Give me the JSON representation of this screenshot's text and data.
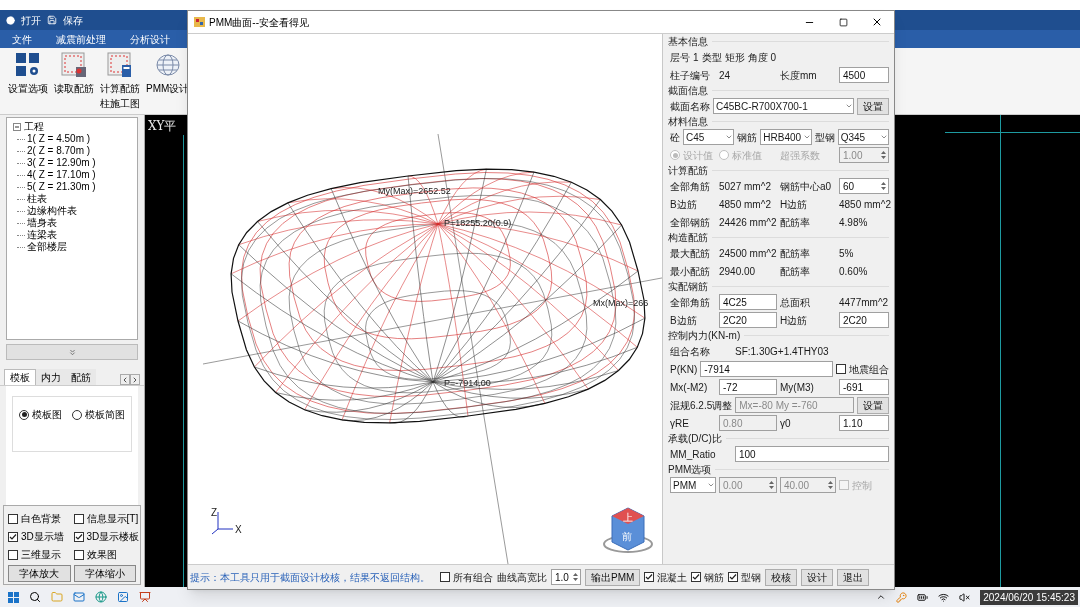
{
  "app": {
    "quick_access": [
      "打开",
      "保存"
    ],
    "menu": [
      "文件",
      "减震前处理",
      "分析设计"
    ],
    "toolbar": [
      {
        "label": "设置选项",
        "kind": "settings"
      },
      {
        "label": "读取配筋",
        "kind": "read"
      },
      {
        "label": "计算配筋",
        "sublabel": "柱施工图",
        "kind": "calc"
      },
      {
        "label": "PMM设计",
        "kind": "sphere"
      }
    ],
    "canvas_title": "XY平"
  },
  "left_panel": {
    "tree": {
      "label": "工程",
      "expanded": true,
      "children": [
        "1( Z = 4.50m )",
        "2( Z = 8.70m )",
        "3( Z = 12.90m )",
        "4( Z = 17.10m )",
        "5( Z = 21.30m )",
        "柱表",
        "边缘构件表",
        "墙身表",
        "连梁表",
        "全部楼层"
      ]
    },
    "tabs": [
      {
        "label": "模板",
        "selected": true
      },
      {
        "label": "内力",
        "selected": false
      },
      {
        "label": "配筋",
        "selected": false
      }
    ],
    "radios": [
      {
        "label": "模板图",
        "selected": true
      },
      {
        "label": "模板简图",
        "selected": false
      }
    ],
    "checkboxes": [
      {
        "label": "白色背景",
        "checked": false
      },
      {
        "label": "信息显示[T]",
        "checked": false
      },
      {
        "label": "3D显示墙",
        "checked": true
      },
      {
        "label": "3D显示楼板",
        "checked": true
      },
      {
        "label": "三维显示",
        "checked": false
      },
      {
        "label": "效果图",
        "checked": false
      }
    ],
    "buttons": [
      "字体放大",
      "字体缩小"
    ]
  },
  "dialog": {
    "title": "PMM曲面--安全看得见",
    "view": {
      "labels": [
        "My(Max)=2652.52",
        "P=18255.20(0.9)",
        "Mx(Max)=266",
        "P=-7914.00"
      ],
      "axes": [
        "Z",
        "X"
      ],
      "cube": [
        "上",
        "前"
      ]
    },
    "right_panel": {
      "sections": [
        {
          "title": "基本信息",
          "groups": [
            {
              "rows": [
                {
                  "cells": [
                    {
                      "kind": "label",
                      "text": "层号"
                    },
                    {
                      "kind": "text",
                      "text": "1"
                    },
                    {
                      "kind": "label",
                      "text": "类型"
                    },
                    {
                      "kind": "text",
                      "text": "矩形"
                    },
                    {
                      "kind": "label",
                      "text": "角度"
                    },
                    {
                      "kind": "text",
                      "text": "0"
                    }
                  ]
                }
              ]
            },
            {
              "rows": [
                {
                  "cells": [
                    {
                      "kind": "label",
                      "text": "柱子编号"
                    },
                    {
                      "kind": "text",
                      "text": "24"
                    },
                    {
                      "kind": "label",
                      "text": "长度mm"
                    },
                    {
                      "kind": "input",
                      "value": "4500"
                    }
                  ]
                }
              ]
            }
          ]
        },
        {
          "title": "截面信息",
          "groups": [
            {
              "rows": [
                {
                  "cells": [
                    {
                      "kind": "label",
                      "text": "截面名称"
                    },
                    {
                      "kind": "select",
                      "value": "C45BC-R700X700-1"
                    },
                    {
                      "kind": "button",
                      "text": "设置"
                    }
                  ]
                }
              ]
            }
          ]
        },
        {
          "title": "材料信息",
          "groups": [
            {
              "rows": [
                {
                  "cells": [
                    {
                      "kind": "label",
                      "text": "砼"
                    },
                    {
                      "kind": "select",
                      "value": "C45"
                    },
                    {
                      "kind": "label",
                      "text": "钢筋"
                    },
                    {
                      "kind": "select",
                      "value": "HRB400"
                    },
                    {
                      "kind": "label",
                      "text": "型钢"
                    },
                    {
                      "kind": "select",
                      "value": "Q345"
                    }
                  ]
                }
              ]
            },
            {
              "rows": [
                {
                  "cells": [
                    {
                      "kind": "radio",
                      "text": "设计值",
                      "selected": true,
                      "disabled": true
                    },
                    {
                      "kind": "radio",
                      "text": "标准值",
                      "selected": false,
                      "disabled": true
                    },
                    {
                      "kind": "label",
                      "text": "超强系数",
                      "disabled": true
                    },
                    {
                      "kind": "spin",
                      "value": "1.00",
                      "disabled": true
                    }
                  ]
                }
              ]
            }
          ]
        },
        {
          "title": "计算配筋",
          "groups": [
            {
              "rows": [
                {
                  "cells": [
                    {
                      "kind": "label",
                      "text": "全部角筋"
                    },
                    {
                      "kind": "text",
                      "text": "5027 mm^2"
                    },
                    {
                      "kind": "label",
                      "text": "钢筋中心a0"
                    },
                    {
                      "kind": "spin",
                      "value": "60"
                    }
                  ]
                },
                {
                  "cells": [
                    {
                      "kind": "label",
                      "text": "B边筋"
                    },
                    {
                      "kind": "text",
                      "text": "4850 mm^2"
                    },
                    {
                      "kind": "label",
                      "text": "H边筋"
                    },
                    {
                      "kind": "text",
                      "text": "4850 mm^2"
                    }
                  ]
                },
                {
                  "cells": [
                    {
                      "kind": "label",
                      "text": "全部钢筋"
                    },
                    {
                      "kind": "text",
                      "text": "24426 mm^2"
                    },
                    {
                      "kind": "label",
                      "text": "配筋率"
                    },
                    {
                      "kind": "text",
                      "text": "4.98%"
                    }
                  ]
                }
              ]
            }
          ]
        },
        {
          "title": "构造配筋",
          "groups": [
            {
              "rows": [
                {
                  "cells": [
                    {
                      "kind": "label",
                      "text": "最大配筋"
                    },
                    {
                      "kind": "text",
                      "text": "24500 mm^2"
                    },
                    {
                      "kind": "label",
                      "text": "配筋率"
                    },
                    {
                      "kind": "text",
                      "text": "5%"
                    }
                  ]
                },
                {
                  "cells": [
                    {
                      "kind": "label",
                      "text": "最小配筋"
                    },
                    {
                      "kind": "text",
                      "text": "2940.00"
                    },
                    {
                      "kind": "label",
                      "text": "配筋率"
                    },
                    {
                      "kind": "text",
                      "text": "0.60%"
                    }
                  ]
                }
              ]
            }
          ]
        },
        {
          "title": "实配钢筋",
          "groups": [
            {
              "rows": [
                {
                  "cells": [
                    {
                      "kind": "label",
                      "text": "全部角筋"
                    },
                    {
                      "kind": "input",
                      "value": "4C25"
                    },
                    {
                      "kind": "label",
                      "text": "总面积"
                    },
                    {
                      "kind": "text",
                      "text": "4477mm^2"
                    }
                  ]
                },
                {
                  "cells": [
                    {
                      "kind": "label",
                      "text": "B边筋"
                    },
                    {
                      "kind": "input",
                      "value": "2C20"
                    },
                    {
                      "kind": "label",
                      "text": "H边筋"
                    },
                    {
                      "kind": "input",
                      "value": "2C20"
                    }
                  ]
                }
              ]
            }
          ]
        },
        {
          "title": "控制内力(KN-m)",
          "groups": [
            {
              "rows": [
                {
                  "cells": [
                    {
                      "kind": "label",
                      "text": "组合名称"
                    },
                    {
                      "kind": "text",
                      "text": "SF:1.30G+1.4THY03"
                    }
                  ]
                }
              ]
            },
            {
              "rows": [
                {
                  "cells": [
                    {
                      "kind": "label",
                      "text": "P(KN)"
                    },
                    {
                      "kind": "input",
                      "value": "-7914"
                    },
                    {
                      "kind": "checkbox",
                      "text": "地震组合",
                      "checked": false
                    }
                  ]
                }
              ]
            },
            {
              "rows": [
                {
                  "cells": [
                    {
                      "kind": "label",
                      "text": "Mx(-M2)"
                    },
                    {
                      "kind": "input",
                      "value": "-72"
                    },
                    {
                      "kind": "label",
                      "text": "My(M3)"
                    },
                    {
                      "kind": "input",
                      "value": "-691"
                    }
                  ]
                }
              ]
            },
            {
              "rows": [
                {
                  "cells": [
                    {
                      "kind": "label",
                      "text": "混规6.2.5调整"
                    },
                    {
                      "kind": "input",
                      "value": "Mx=-80 My =-760",
                      "disabled": true
                    },
                    {
                      "kind": "button",
                      "text": "设置"
                    }
                  ]
                }
              ]
            },
            {
              "rows": [
                {
                  "cells": [
                    {
                      "kind": "label",
                      "text": "γRE"
                    },
                    {
                      "kind": "input",
                      "value": "0.80",
                      "disabled": true
                    },
                    {
                      "kind": "label",
                      "text": "γ0"
                    },
                    {
                      "kind": "input",
                      "value": "1.10"
                    }
                  ]
                }
              ]
            }
          ]
        },
        {
          "title": "承载(D/C)比",
          "groups": [
            {
              "rows": [
                {
                  "cells": [
                    {
                      "kind": "label",
                      "text": "MM_Ratio"
                    },
                    {
                      "kind": "input",
                      "value": "100"
                    }
                  ]
                }
              ]
            }
          ]
        },
        {
          "title": "PMM选项",
          "groups": [
            {
              "rows": [
                {
                  "cells": [
                    {
                      "kind": "select",
                      "value": "PMM"
                    },
                    {
                      "kind": "spin",
                      "value": "0.00",
                      "disabled": true
                    },
                    {
                      "kind": "spin",
                      "value": "40.00",
                      "disabled": true
                    },
                    {
                      "kind": "checkbox",
                      "text": "控制",
                      "checked": false,
                      "disabled": true
                    }
                  ]
                }
              ]
            }
          ]
        }
      ]
    },
    "bottom_bar": {
      "hint": "提示：本工具只用于截面设计校核，结果不返回结构。",
      "items": [
        {
          "kind": "checkbox",
          "text": "所有组合",
          "checked": false
        },
        {
          "kind": "label",
          "text": "曲线高宽比"
        },
        {
          "kind": "spin",
          "value": "1.0"
        },
        {
          "kind": "button",
          "text": "输出PMM"
        },
        {
          "kind": "checkbox",
          "text": "混凝土",
          "checked": true
        },
        {
          "kind": "checkbox",
          "text": "钢筋",
          "checked": true
        },
        {
          "kind": "checkbox",
          "text": "型钢",
          "checked": true
        },
        {
          "kind": "button",
          "text": "校核"
        },
        {
          "kind": "button",
          "text": "设计"
        },
        {
          "kind": "button",
          "text": "退出"
        }
      ]
    }
  },
  "taskbar": {
    "clock": "2024/06/20 15:45:23"
  }
}
